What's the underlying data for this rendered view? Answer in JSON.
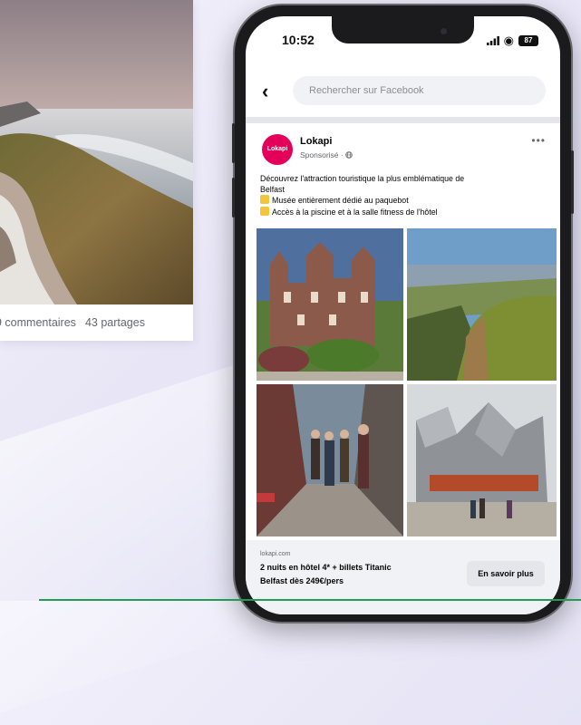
{
  "post": {
    "comments": "9 commentaires",
    "shares": "43 partages"
  },
  "phone": {
    "time": "10:52",
    "battery": "87",
    "search_placeholder": "Rechercher sur Facebook"
  },
  "ad": {
    "avatar_text": "Lokapi",
    "advertiser": "Lokapi",
    "sponsored": "Sponsorisé · ",
    "text_line1": "Découvrez l'attraction touristique la plus emblématique de",
    "text_line2": "Belfast",
    "bullet1": "Musée entièrement dédié au paquebot",
    "bullet2": "Accès à la piscine et à la salle fitness de l'hôtel",
    "cta_source": "lokapi.com",
    "cta_title_line1": "2 nuits en hôtel 4* + billets Titanic",
    "cta_title_line2": "Belfast dès 249€/pers",
    "cta_button": "En savoir plus"
  },
  "icons": {
    "back": "back-arrow-icon",
    "more": "more-options-icon",
    "wifi": "wifi-icon",
    "battery": "battery-icon",
    "globe": "globe-icon",
    "thumb": "thumbs-up-icon"
  },
  "colors": {
    "brand": "#e4005a",
    "facebook_grey": "#f0f2f5",
    "accent_line": "#1f9d55"
  }
}
